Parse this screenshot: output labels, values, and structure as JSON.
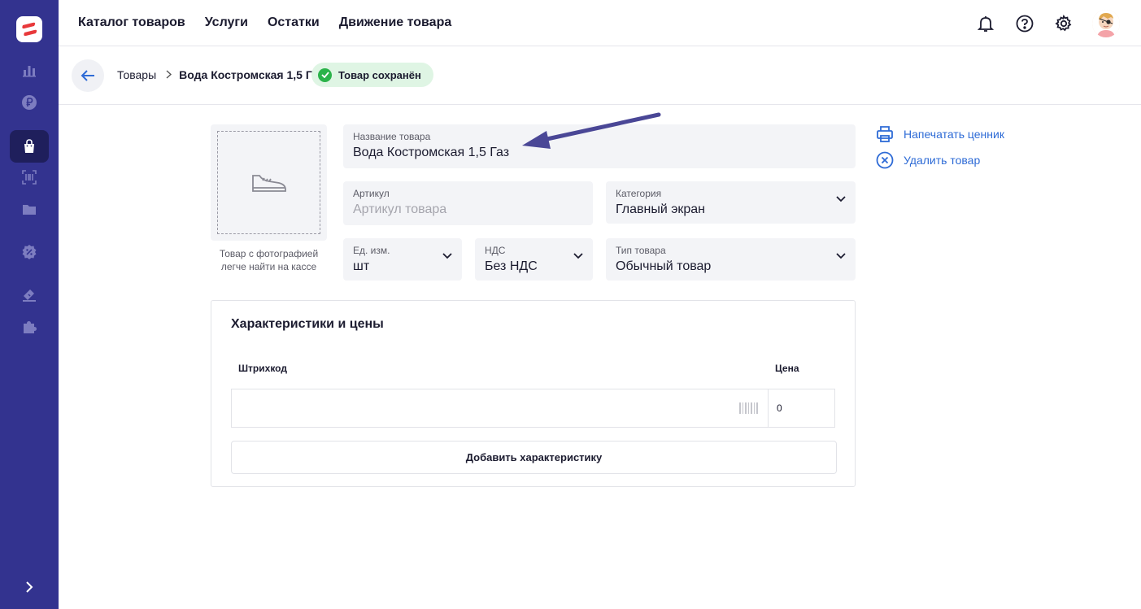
{
  "nav": {
    "items": [
      "Каталог товаров",
      "Услуги",
      "Остатки",
      "Движение товара"
    ]
  },
  "sidebar": {
    "icons": [
      "chart-icon",
      "ruble-icon",
      "shopping-bag-icon",
      "barcode-scan-icon",
      "folder-icon",
      "discount-icon",
      "ticket-icon",
      "puzzle-icon"
    ],
    "active": "shopping-bag-icon"
  },
  "breadcrumb": {
    "parent": "Товары",
    "current": "Вода Костромская 1,5 Газ",
    "status": "Товар сохранён"
  },
  "photo": {
    "hint_line1": "Товар с фотографией",
    "hint_line2": "легче найти на кассе"
  },
  "form": {
    "name": {
      "label": "Название товара",
      "value": "Вода Костромская 1,5 Газ"
    },
    "sku": {
      "label": "Артикул",
      "placeholder": "Артикул товара"
    },
    "category": {
      "label": "Категория",
      "value": "Главный экран"
    },
    "unit": {
      "label": "Ед. изм.",
      "value": "шт"
    },
    "vat": {
      "label": "НДС",
      "value": "Без НДС"
    },
    "type": {
      "label": "Тип товара",
      "value": "Обычный товар"
    }
  },
  "actions": {
    "print": "Напечатать ценник",
    "delete": "Удалить товар"
  },
  "characteristics": {
    "title": "Характеристики и цены",
    "col_barcode": "Штрихкод",
    "col_price": "Цена",
    "price_value": "0",
    "add_button": "Добавить характеристику"
  },
  "colors": {
    "sidebar": "#33338f",
    "accent_link": "#2e6bd6",
    "success": "#2bb34a",
    "annotation_arrow": "#4a4796"
  }
}
